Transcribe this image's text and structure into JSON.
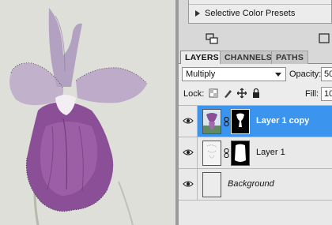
{
  "panel": {
    "presets_label": "Selective Color Presets",
    "tabs": [
      {
        "label": "LAYERS",
        "active": true
      },
      {
        "label": "CHANNELS",
        "active": false
      },
      {
        "label": "PATHS",
        "active": false
      }
    ],
    "blend_mode": "Multiply",
    "opacity_label": "Opacity:",
    "opacity_value": "50",
    "lock_label": "Lock:",
    "fill_label": "Fill:",
    "fill_value": "10",
    "layers": [
      {
        "name": "Layer 1 copy",
        "selected": true,
        "visible": true
      },
      {
        "name": "Layer 1",
        "selected": false,
        "visible": true
      },
      {
        "name": "Background",
        "selected": false,
        "visible": true,
        "italic": true
      }
    ],
    "accent_color": "#3b94ee"
  },
  "canvas": {
    "subject": "orchid-flower-image"
  }
}
